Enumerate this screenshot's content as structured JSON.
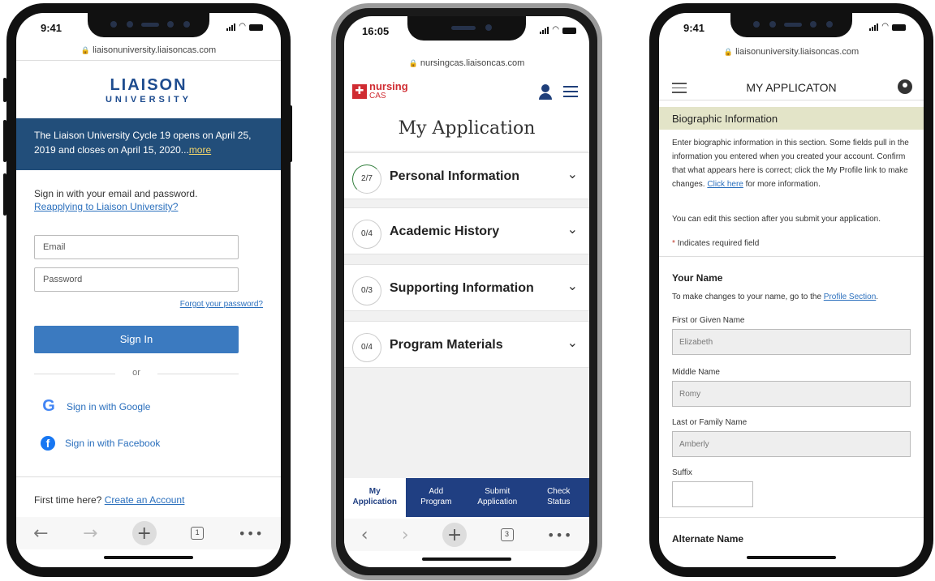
{
  "phone1": {
    "time": "9:41",
    "url": "liaisonuniversity.liaisoncas.com",
    "logo_line1": "LIAISON",
    "logo_line2": "UNIVERSITY",
    "banner_text": "The Liaison University Cycle 19 opens on April 25, 2019 and closes on April 15, 2020...",
    "banner_more": "more",
    "signin_prompt": "Sign in with your email and password.",
    "reapply_link": "Reapplying to Liaison University?",
    "email_placeholder": "Email",
    "password_placeholder": "Password",
    "forgot_link": "Forgot your password?",
    "signin_button": "Sign In",
    "or_text": "or",
    "google_label": "Sign in with Google",
    "facebook_label": "Sign in with Facebook",
    "first_time": "First time here?",
    "create_account": "Create an Account",
    "tab_count": "1"
  },
  "phone2": {
    "time": "16:05",
    "url": "nursingcas.liaisoncas.com",
    "logo_top": "nursing",
    "logo_bottom": "CAS",
    "page_title": "My Application",
    "sections": [
      {
        "progress": "2/7",
        "label": "Personal Information"
      },
      {
        "progress": "0/4",
        "label": "Academic History"
      },
      {
        "progress": "0/3",
        "label": "Supporting Information"
      },
      {
        "progress": "0/4",
        "label": "Program Materials"
      }
    ],
    "tabs": [
      {
        "line1": "My",
        "line2": "Application"
      },
      {
        "line1": "Add",
        "line2": "Program"
      },
      {
        "line1": "Submit",
        "line2": "Application"
      },
      {
        "line1": "Check",
        "line2": "Status"
      }
    ],
    "tab_count": "3"
  },
  "phone3": {
    "time": "9:41",
    "url": "liaisonuniversity.liaisoncas.com",
    "header_title": "MY APPLICATON",
    "section_title": "Biographic Information",
    "intro_text": "Enter biographic information in this section. Some fields pull in the information you entered when you created your account. Confirm that what appears here is correct; click the My Profile link to make changes.",
    "click_here": "Click here",
    "intro_tail": "for more information.",
    "edit_note": "You can edit this section after you submit your application.",
    "required_mark": "*",
    "required_note": "Indicates required field",
    "your_name_heading": "Your Name",
    "name_change_text": "To make changes to your name, go to the",
    "profile_link": "Profile Section",
    "period": ".",
    "fields": [
      {
        "label": "First or Given Name",
        "value": "Elizabeth"
      },
      {
        "label": "Middle Name",
        "value": "Romy"
      },
      {
        "label": "Last or Family Name",
        "value": "Amberly"
      }
    ],
    "suffix_label": "Suffix",
    "alternate_name_heading": "Alternate Name"
  }
}
